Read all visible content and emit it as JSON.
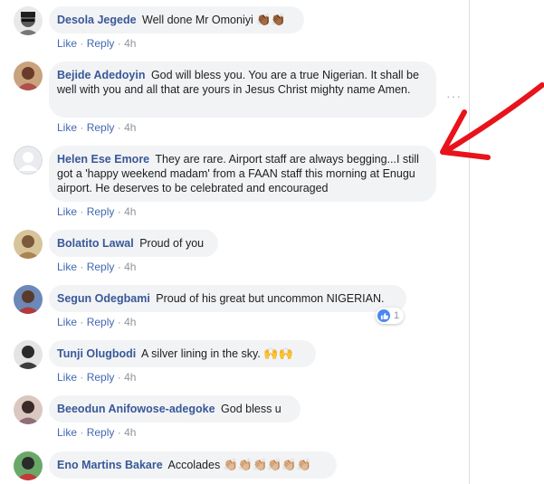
{
  "actions": {
    "like": "Like",
    "reply": "Reply",
    "separator": "·"
  },
  "comments": [
    {
      "author": "Desola Jegede",
      "text": "Well done Mr Omoniyi",
      "emoji": "👏🏾👏🏾",
      "time": "4h",
      "avatar_color": "#8c8c8c"
    },
    {
      "author": "Bejide Adedoyin",
      "text": "God will bless you. You are a true Nigerian. It shall be well with you and all that are yours in Jesus Christ mighty name Amen.",
      "emoji": "",
      "time": "4h",
      "avatar_color": "#b0504b"
    },
    {
      "author": "Helen Ese Emore",
      "text": "They are rare. Airport staff are always begging...I still got a 'happy weekend madam' from a FAAN staff this morning at Enugu airport. He deserves to be celebrated and encouraged",
      "emoji": "",
      "time": "4h",
      "avatar_color": "#d8dadf"
    },
    {
      "author": "Bolatito Lawal",
      "text": "Proud of you",
      "emoji": "",
      "time": "4h",
      "avatar_color": "#a9854f"
    },
    {
      "author": "Segun Odegbami",
      "text": "Proud of his great but uncommon NIGERIAN.",
      "emoji": "",
      "time": "4h",
      "avatar_color": "#b43a3a",
      "reaction_count": "1"
    },
    {
      "author": "Tunji Olugbodi",
      "text": "A silver lining in the sky.",
      "emoji": "🙌🙌",
      "time": "4h",
      "avatar_color": "#3d3d3d"
    },
    {
      "author": "Beeodun Anifowose-adegoke",
      "text": "God bless u",
      "emoji": "",
      "time": "4h",
      "avatar_color": "#8f6e7a"
    },
    {
      "author": "Eno Martins Bakare",
      "text": "Accolades",
      "emoji": "👏🏼👏🏼👏🏼👏🏼👏🏼👏🏼",
      "time": "",
      "avatar_color": "#2f7a2f"
    }
  ],
  "more_icon": "···",
  "colors": {
    "author": "#385898",
    "link": "#4267b2",
    "bubble": "#f2f3f5",
    "arrow": "#e8131b"
  }
}
